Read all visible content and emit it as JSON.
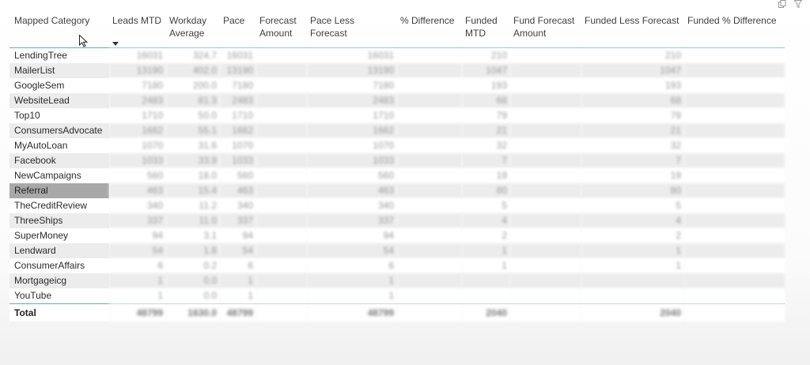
{
  "header": {
    "columns": [
      "Mapped Category",
      "Leads MTD",
      "Workday Average",
      "Pace",
      "Forecast Amount",
      "Pace Less Forecast",
      "% Difference",
      "Funded MTD",
      "Fund Forecast Amount",
      "Funded Less Forecast",
      "Funded % Difference"
    ]
  },
  "rows": [
    {
      "name": "LendingTree",
      "leads": "16031",
      "avg": "324.7",
      "pace": "16031",
      "forecast": "",
      "pace_less": "16031",
      "pct": "",
      "funded": "210",
      "fund_forecast": "",
      "funded_less": "210",
      "funded_pct": ""
    },
    {
      "name": "MailerList",
      "leads": "13190",
      "avg": "402.0",
      "pace": "13190",
      "forecast": "",
      "pace_less": "13190",
      "pct": "",
      "funded": "1047",
      "fund_forecast": "",
      "funded_less": "1047",
      "funded_pct": ""
    },
    {
      "name": "GoogleSem",
      "leads": "7180",
      "avg": "200.0",
      "pace": "7180",
      "forecast": "",
      "pace_less": "7180",
      "pct": "",
      "funded": "193",
      "fund_forecast": "",
      "funded_less": "193",
      "funded_pct": ""
    },
    {
      "name": "WebsiteLead",
      "leads": "2483",
      "avg": "81.3",
      "pace": "2483",
      "forecast": "",
      "pace_less": "2483",
      "pct": "",
      "funded": "68",
      "fund_forecast": "",
      "funded_less": "68",
      "funded_pct": ""
    },
    {
      "name": "Top10",
      "leads": "1710",
      "avg": "50.0",
      "pace": "1710",
      "forecast": "",
      "pace_less": "1710",
      "pct": "",
      "funded": "79",
      "fund_forecast": "",
      "funded_less": "79",
      "funded_pct": ""
    },
    {
      "name": "ConsumersAdvocate",
      "leads": "1662",
      "avg": "55.1",
      "pace": "1662",
      "forecast": "",
      "pace_less": "1662",
      "pct": "",
      "funded": "21",
      "fund_forecast": "",
      "funded_less": "21",
      "funded_pct": ""
    },
    {
      "name": "MyAutoLoan",
      "leads": "1070",
      "avg": "31.6",
      "pace": "1070",
      "forecast": "",
      "pace_less": "1070",
      "pct": "",
      "funded": "32",
      "fund_forecast": "",
      "funded_less": "32",
      "funded_pct": ""
    },
    {
      "name": "Facebook",
      "leads": "1033",
      "avg": "33.9",
      "pace": "1033",
      "forecast": "",
      "pace_less": "1033",
      "pct": "",
      "funded": "7",
      "fund_forecast": "",
      "funded_less": "7",
      "funded_pct": ""
    },
    {
      "name": "NewCampaigns",
      "leads": "560",
      "avg": "18.0",
      "pace": "560",
      "forecast": "",
      "pace_less": "560",
      "pct": "",
      "funded": "19",
      "fund_forecast": "",
      "funded_less": "19",
      "funded_pct": ""
    },
    {
      "name": "Referral",
      "leads": "463",
      "avg": "15.4",
      "pace": "463",
      "forecast": "",
      "pace_less": "463",
      "pct": "",
      "funded": "80",
      "fund_forecast": "",
      "funded_less": "80",
      "funded_pct": "",
      "selected": true
    },
    {
      "name": "TheCreditReview",
      "leads": "340",
      "avg": "11.2",
      "pace": "340",
      "forecast": "",
      "pace_less": "340",
      "pct": "",
      "funded": "5",
      "fund_forecast": "",
      "funded_less": "5",
      "funded_pct": ""
    },
    {
      "name": "ThreeShips",
      "leads": "337",
      "avg": "11.0",
      "pace": "337",
      "forecast": "",
      "pace_less": "337",
      "pct": "",
      "funded": "4",
      "fund_forecast": "",
      "funded_less": "4",
      "funded_pct": ""
    },
    {
      "name": "SuperMoney",
      "leads": "94",
      "avg": "3.1",
      "pace": "94",
      "forecast": "",
      "pace_less": "94",
      "pct": "",
      "funded": "2",
      "fund_forecast": "",
      "funded_less": "2",
      "funded_pct": ""
    },
    {
      "name": "Lendward",
      "leads": "54",
      "avg": "1.8",
      "pace": "54",
      "forecast": "",
      "pace_less": "54",
      "pct": "",
      "funded": "1",
      "fund_forecast": "",
      "funded_less": "1",
      "funded_pct": ""
    },
    {
      "name": "ConsumerAffairs",
      "leads": "6",
      "avg": "0.2",
      "pace": "6",
      "forecast": "",
      "pace_less": "6",
      "pct": "",
      "funded": "1",
      "fund_forecast": "",
      "funded_less": "1",
      "funded_pct": ""
    },
    {
      "name": "Mortgageicg",
      "leads": "1",
      "avg": "0.0",
      "pace": "1",
      "forecast": "",
      "pace_less": "1",
      "pct": "",
      "funded": "",
      "fund_forecast": "",
      "funded_less": "",
      "funded_pct": ""
    },
    {
      "name": "YouTube",
      "leads": "1",
      "avg": "0.0",
      "pace": "1",
      "forecast": "",
      "pace_less": "1",
      "pct": "",
      "funded": "",
      "fund_forecast": "",
      "funded_less": "",
      "funded_pct": ""
    }
  ],
  "total": {
    "label": "Total",
    "leads": "48799",
    "avg": "1630.0",
    "pace": "48799",
    "forecast": "",
    "pace_less": "48799",
    "pct": "",
    "funded": "2040",
    "fund_forecast": "",
    "funded_less": "2040",
    "funded_pct": ""
  },
  "icons": {
    "top_right": [
      "copy-icon",
      "filter-icon"
    ]
  }
}
